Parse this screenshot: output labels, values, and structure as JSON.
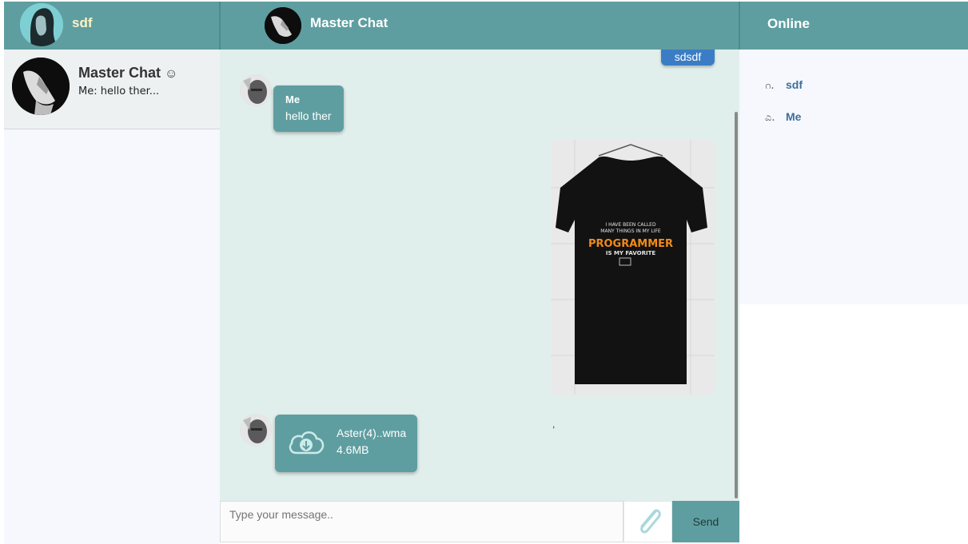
{
  "header": {
    "current_user": "sdf",
    "chat_title": "Master Chat",
    "online_title": "Online"
  },
  "sidebar": {
    "conversations": [
      {
        "name": "Master Chat",
        "emoji": "☺",
        "preview": "Me: hello ther..."
      }
    ]
  },
  "chat": {
    "messages": [
      {
        "type": "text",
        "direction": "out",
        "text": "sdsdf"
      },
      {
        "type": "text",
        "direction": "in",
        "sender": "Me",
        "text": "hello ther"
      },
      {
        "type": "image",
        "direction": "out",
        "description": "black t-shirt"
      },
      {
        "type": "file",
        "direction": "in",
        "file_name": "Aster(4)..wma",
        "file_size": "4.6MB"
      }
    ],
    "stray_mark": ","
  },
  "composer": {
    "placeholder": "Type your message..",
    "send_label": "Send",
    "attach_icon": "paperclip-icon"
  },
  "online": {
    "users": [
      {
        "marker": "ဂ.",
        "name": "sdf"
      },
      {
        "marker": "ಎ.",
        "name": "Me"
      }
    ]
  },
  "colors": {
    "teal": "#5f9ea0",
    "chat_bg": "#e0efec",
    "outgoing_bubble": "#3b7dc4",
    "panel_bg": "#f6f8fd",
    "online_link": "#3d6f9c"
  }
}
